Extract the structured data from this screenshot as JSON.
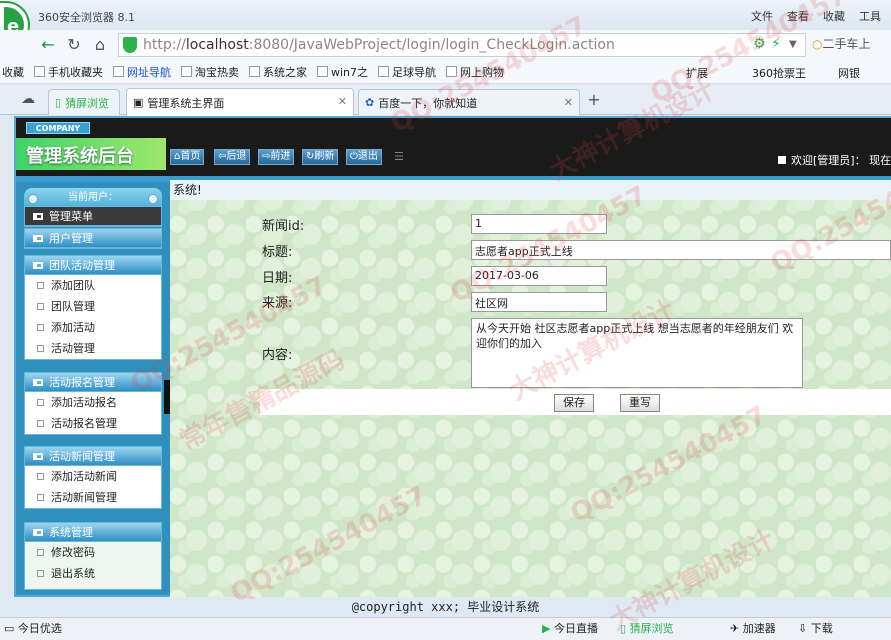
{
  "browser": {
    "title": "360安全浏览器 8.1",
    "menu": [
      "文件",
      "查看",
      "收藏",
      "工具"
    ],
    "url_prefix": "http://",
    "url_host": "localhost",
    "url_rest": ":8080/JavaWebProject/login/login_CheckLogin.action",
    "search_text": "二手车上",
    "favorites": [
      {
        "label": "收藏"
      },
      {
        "label": "手机收藏夹"
      },
      {
        "label": "网址导航"
      },
      {
        "label": "淘宝热卖"
      },
      {
        "label": "系统之家"
      },
      {
        "label": "win7之"
      },
      {
        "label": "足球导航"
      },
      {
        "label": "网上购物"
      }
    ],
    "fav_right": [
      "扩展",
      "360抢票王",
      "网银"
    ],
    "tabs": [
      {
        "label": "猜屏浏览"
      },
      {
        "label": "管理系统主界面"
      },
      {
        "label": "百度一下，你就知道"
      }
    ]
  },
  "header": {
    "company": "COMPANY",
    "brand": "管理系统后台",
    "buttons": [
      "首页",
      "后退",
      "前进",
      "刷新",
      "退出"
    ],
    "welcome": "欢迎[管理员]：  现在"
  },
  "sidebar": {
    "current_user": "当前用户：",
    "sections": [
      {
        "title": "管理菜单",
        "items": []
      },
      {
        "title": "用户管理",
        "items": []
      },
      {
        "title": "团队活动管理",
        "items": [
          "添加团队",
          "团队管理",
          "添加活动",
          "活动管理"
        ]
      },
      {
        "title": "活动报名管理",
        "items": [
          "添加活动报名",
          "活动报名管理"
        ]
      },
      {
        "title": "活动新闻管理",
        "items": [
          "添加活动新闻",
          "活动新闻管理"
        ]
      },
      {
        "title": "系统管理",
        "items": [
          "修改密码",
          "退出系统"
        ]
      }
    ]
  },
  "content": {
    "breadcrumb": "系统!",
    "form": {
      "id_label": "新闻id:",
      "id_value": "1",
      "title_label": "标题:",
      "title_value": "志愿者app正式上线",
      "date_label": "日期:",
      "date_value": "2017-03-06",
      "source_label": "来源:",
      "source_value": "社区网",
      "content_label": "内容:",
      "content_value": "从今天开始 社区志愿者app正式上线 想当志愿者的年经朋友们 欢迎你们的加入"
    },
    "save_label": "保存",
    "reset_label": "重写"
  },
  "footer": "@copyright xxx; 毕业设计系统",
  "statusbar": {
    "left": "今日优选",
    "right": [
      "今日直播",
      "猜屏浏览",
      "加速器",
      "下载"
    ]
  },
  "watermark": [
    "QQ:254540457",
    "大神计算机设计",
    "常年售精品源码"
  ]
}
